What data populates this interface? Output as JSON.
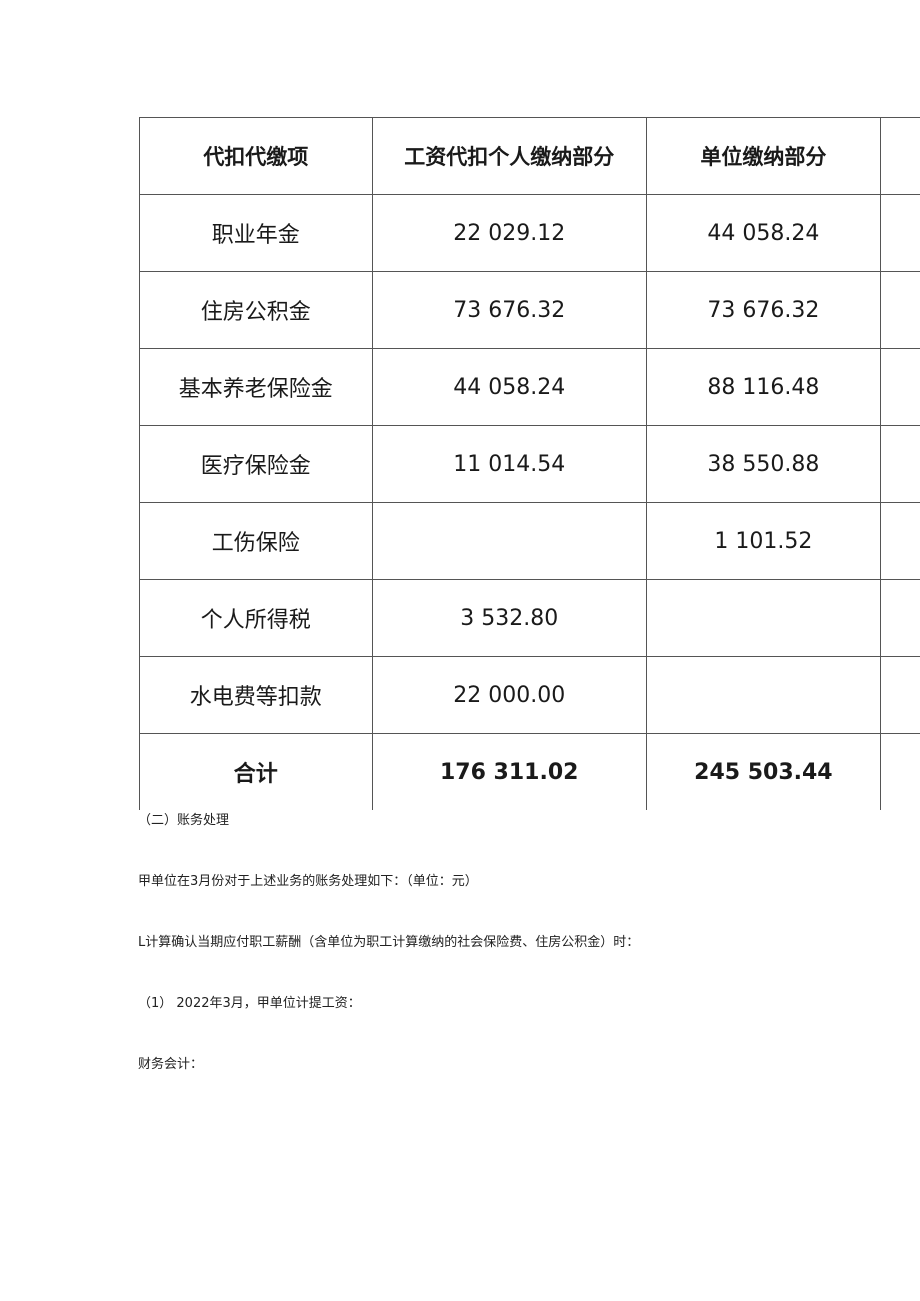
{
  "table": {
    "headers": [
      "代扣代缴项",
      "工资代扣个人缴纳部分",
      "单位缴纳部分",
      ""
    ],
    "rows": [
      {
        "item": "职业年金",
        "personal": "22 029.12",
        "unit": "44 058.24"
      },
      {
        "item": "住房公积金",
        "personal": "73 676.32",
        "unit": "73 676.32"
      },
      {
        "item": "基本养老保险金",
        "personal": "44 058.24",
        "unit": "88 116.48"
      },
      {
        "item": "医疗保险金",
        "personal": "11 014.54",
        "unit": "38 550.88"
      },
      {
        "item": "工伤保险",
        "personal": "",
        "unit": "1 101.52"
      },
      {
        "item": "个人所得税",
        "personal": "3 532.80",
        "unit": ""
      },
      {
        "item": "水电费等扣款",
        "personal": "22 000.00",
        "unit": ""
      }
    ],
    "total": {
      "item": "合计",
      "personal": "176 311.02",
      "unit": "245 503.44"
    }
  },
  "paragraphs": [
    "（二）账务处理",
    "甲单位在3月份对于上述业务的账务处理如下：（单位：元）",
    "L计算确认当期应付职工薪酬（含单位为职工计算缴纳的社会保险费、住房公积金）时：",
    "（1） 2022年3月，甲单位计提工资：",
    "财务会计："
  ]
}
